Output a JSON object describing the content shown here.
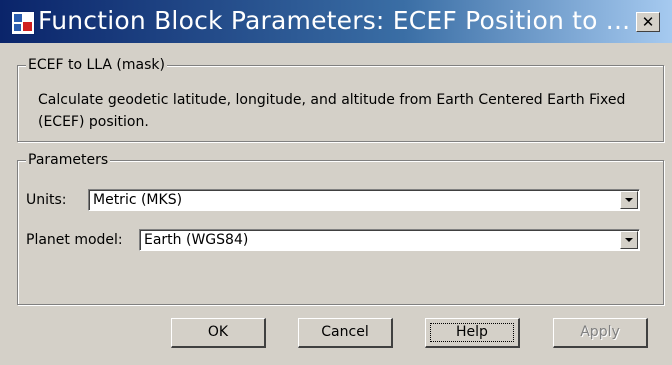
{
  "window": {
    "title": "Function Block Parameters: ECEF Position to ...",
    "close_label": "✕",
    "icon": "simulink-block-icon"
  },
  "mask_group": {
    "label": "ECEF to LLA (mask)",
    "description": "Calculate geodetic latitude, longitude, and altitude from Earth Centered Earth Fixed (ECEF) position."
  },
  "params_group": {
    "label": "Parameters",
    "units": {
      "label": "Units:",
      "value": "Metric (MKS)"
    },
    "planet": {
      "label": "Planet model:",
      "value": "Earth (WGS84)"
    }
  },
  "buttons": {
    "ok": "OK",
    "cancel": "Cancel",
    "help": "Help",
    "apply": "Apply"
  },
  "colors": {
    "dialog_bg": "#d4d0c8",
    "title_start": "#0a246a",
    "title_end": "#a6caf0",
    "disabled_text": "#808080"
  }
}
